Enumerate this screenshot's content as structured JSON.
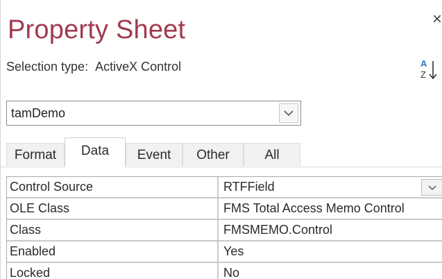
{
  "panel": {
    "title": "Property Sheet",
    "close_glyph": "×",
    "selection_type_label": "Selection type:",
    "selection_type_value": "ActiveX Control",
    "sort_icon": "sort-a-z-icon"
  },
  "object_selector": {
    "value": "tamDemo",
    "dropdown_icon": "chevron-down-icon"
  },
  "tabs": [
    {
      "label": "Format",
      "active": false
    },
    {
      "label": "Data",
      "active": true
    },
    {
      "label": "Event",
      "active": false
    },
    {
      "label": "Other",
      "active": false
    },
    {
      "label": "All",
      "active": false
    }
  ],
  "properties": [
    {
      "name": "Control Source",
      "value": "RTFField",
      "has_dropdown": true
    },
    {
      "name": "OLE Class",
      "value": "FMS Total Access Memo Control",
      "has_dropdown": false
    },
    {
      "name": "Class",
      "value": "FMSMEMO.Control",
      "has_dropdown": false
    },
    {
      "name": "Enabled",
      "value": "Yes",
      "has_dropdown": false
    },
    {
      "name": "Locked",
      "value": "No",
      "has_dropdown": false
    }
  ],
  "colors": {
    "title": "#a23a4f",
    "border": "#c9c9c9"
  }
}
